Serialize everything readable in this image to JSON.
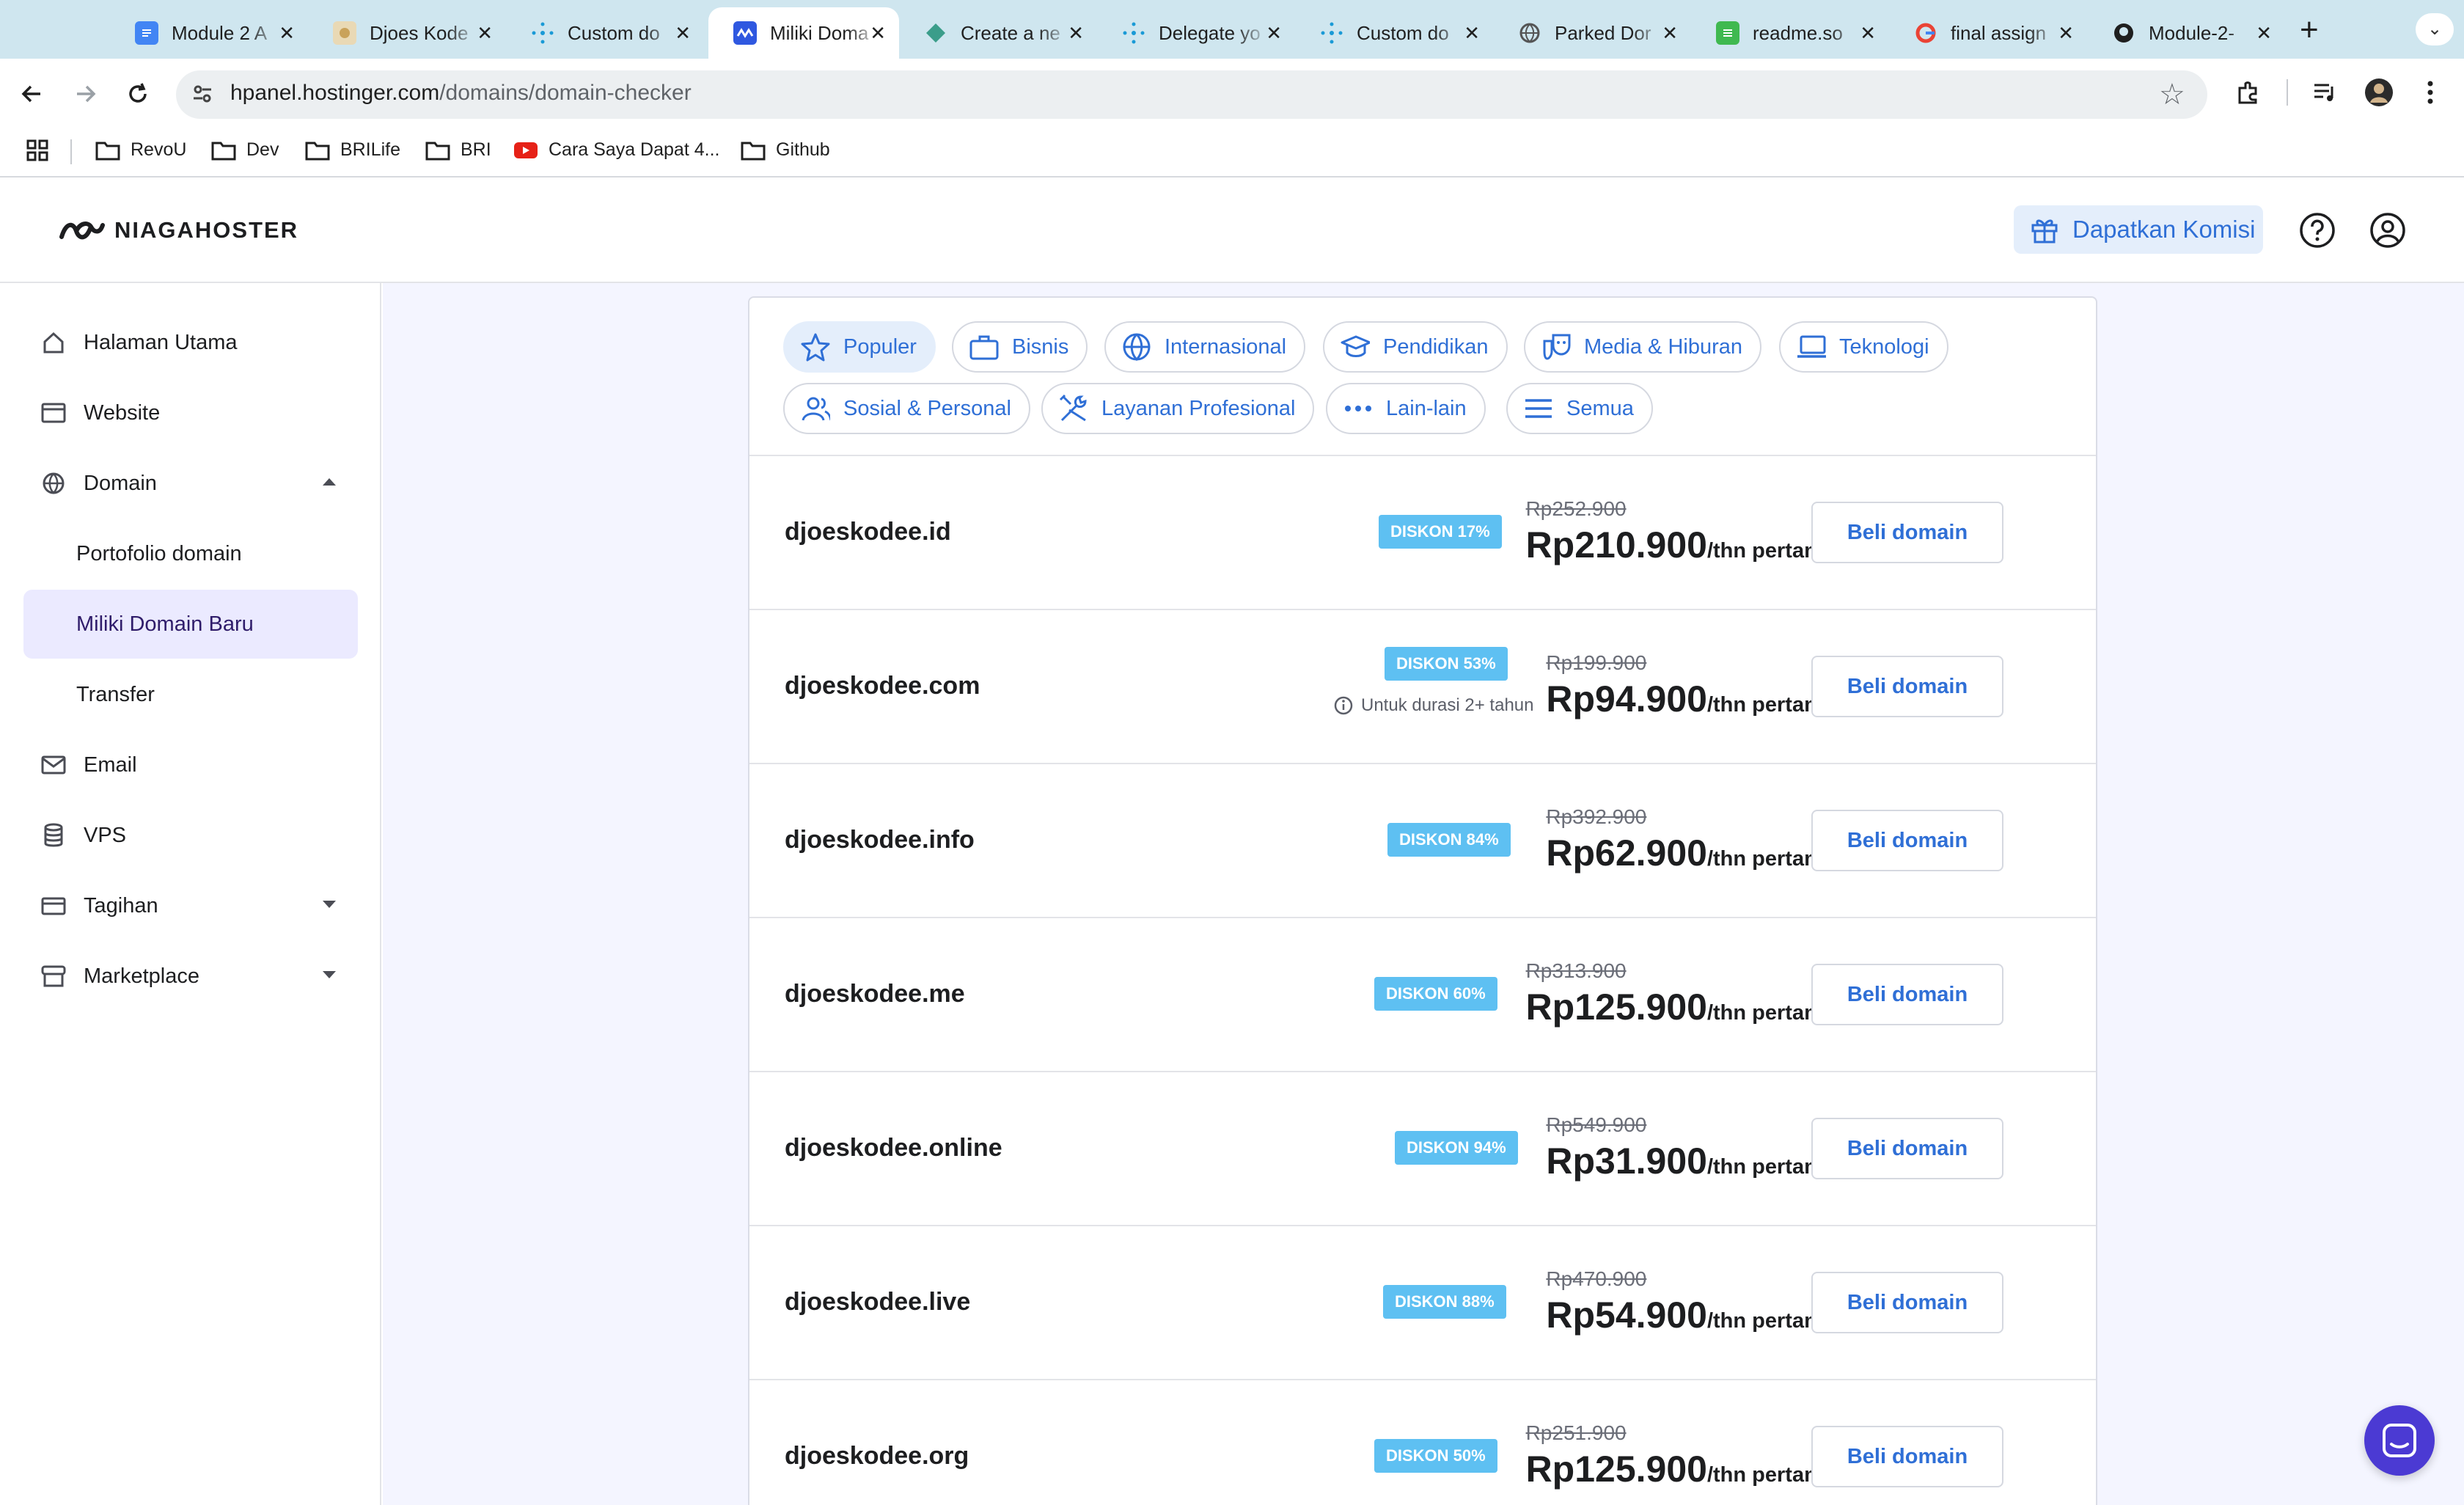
{
  "browser": {
    "tabs": [
      {
        "title": "Module 2 A",
        "favicon": "google-docs-icon",
        "color": "#4285f4"
      },
      {
        "title": "Djoes Kode",
        "favicon": "cat-avatar-icon",
        "color": "#c9a25a"
      },
      {
        "title": "Custom do",
        "favicon": "network-icon",
        "color": "#1a9ad6"
      },
      {
        "title": "Miliki Doma",
        "favicon": "niagahoster-icon",
        "color": "#2f58e0",
        "active": true
      },
      {
        "title": "Create a ne",
        "favicon": "diamond-icon",
        "color": "#3b9d8a"
      },
      {
        "title": "Delegate yo",
        "favicon": "network-icon",
        "color": "#1a9ad6"
      },
      {
        "title": "Custom do",
        "favicon": "network-icon",
        "color": "#1a9ad6"
      },
      {
        "title": "Parked Dor",
        "favicon": "globe-icon",
        "color": "#555555"
      },
      {
        "title": "readme.so",
        "favicon": "readme-icon",
        "color": "#3fb950"
      },
      {
        "title": "final assign",
        "favicon": "google-icon",
        "color": "#ea4335"
      },
      {
        "title": "Module-2-",
        "favicon": "github-icon",
        "color": "#1f1f1f"
      }
    ],
    "url_host": "hpanel.hostinger.com",
    "url_path": "/domains/domain-checker",
    "bookmarks": [
      {
        "label": "RevoU",
        "icon": "folder-icon"
      },
      {
        "label": "Dev",
        "icon": "folder-icon"
      },
      {
        "label": "BRILife",
        "icon": "folder-icon"
      },
      {
        "label": "BRI",
        "icon": "folder-icon"
      },
      {
        "label": "Cara Saya Dapat 4...",
        "icon": "youtube-icon"
      },
      {
        "label": "Github",
        "icon": "folder-icon"
      }
    ]
  },
  "header": {
    "logo_text": "NIAGAHOSTER",
    "komisi_label": "Dapatkan Komisi"
  },
  "sidebar": {
    "items": [
      {
        "label": "Halaman Utama",
        "icon": "home-icon"
      },
      {
        "label": "Website",
        "icon": "browser-window-icon"
      },
      {
        "label": "Domain",
        "icon": "globe-icon",
        "expanded": true
      },
      {
        "label": "Portofolio domain",
        "sub": true
      },
      {
        "label": "Miliki Domain Baru",
        "sub": true,
        "active": true
      },
      {
        "label": "Transfer",
        "sub": true
      },
      {
        "label": "Email",
        "icon": "mail-icon"
      },
      {
        "label": "VPS",
        "icon": "database-icon"
      },
      {
        "label": "Tagihan",
        "icon": "credit-card-icon",
        "expandable": true
      },
      {
        "label": "Marketplace",
        "icon": "store-icon",
        "expandable": true
      }
    ]
  },
  "categories": [
    {
      "label": "Populer",
      "icon": "star-icon",
      "active": true
    },
    {
      "label": "Bisnis",
      "icon": "briefcase-icon"
    },
    {
      "label": "Internasional",
      "icon": "globe-icon"
    },
    {
      "label": "Pendidikan",
      "icon": "graduation-cap-icon"
    },
    {
      "label": "Media & Hiburan",
      "icon": "theater-masks-icon"
    },
    {
      "label": "Teknologi",
      "icon": "laptop-icon"
    },
    {
      "label": "Sosial & Personal",
      "icon": "users-icon"
    },
    {
      "label": "Layanan Profesional",
      "icon": "tools-icon"
    },
    {
      "label": "Lain-lain",
      "icon": "dots-icon"
    },
    {
      "label": "Semua",
      "icon": "menu-lines-icon"
    }
  ],
  "domains": [
    {
      "name": "djoeskodee.id",
      "badge": "DISKON 17%",
      "old_price": "Rp252.900",
      "price": "Rp210.900",
      "per": "/thn pertama",
      "button": "Beli domain"
    },
    {
      "name": "djoeskodee.com",
      "badge": "DISKON 53%",
      "old_price": "Rp199.900",
      "price": "Rp94.900",
      "per": "/thn pertama",
      "note": "Untuk durasi 2+ tahun",
      "button": "Beli domain"
    },
    {
      "name": "djoeskodee.info",
      "badge": "DISKON 84%",
      "old_price": "Rp392.900",
      "price": "Rp62.900",
      "per": "/thn pertama",
      "button": "Beli domain"
    },
    {
      "name": "djoeskodee.me",
      "badge": "DISKON 60%",
      "old_price": "Rp313.900",
      "price": "Rp125.900",
      "per": "/thn pertama",
      "button": "Beli domain"
    },
    {
      "name": "djoeskodee.online",
      "badge": "DISKON 94%",
      "old_price": "Rp549.900",
      "price": "Rp31.900",
      "per": "/thn pertama",
      "button": "Beli domain"
    },
    {
      "name": "djoeskodee.live",
      "badge": "DISKON 88%",
      "old_price": "Rp470.900",
      "price": "Rp54.900",
      "per": "/thn pertama",
      "button": "Beli domain"
    },
    {
      "name": "djoeskodee.org",
      "badge": "DISKON 50%",
      "old_price": "Rp251.900",
      "price": "Rp125.900",
      "per": "/thn pertama",
      "button": "Beli domain"
    }
  ],
  "colors": {
    "accent": "#2f6fd6",
    "badge": "#5ec0f2",
    "sidebar_active": "#ebeaff",
    "chat": "#4b3ad3"
  }
}
